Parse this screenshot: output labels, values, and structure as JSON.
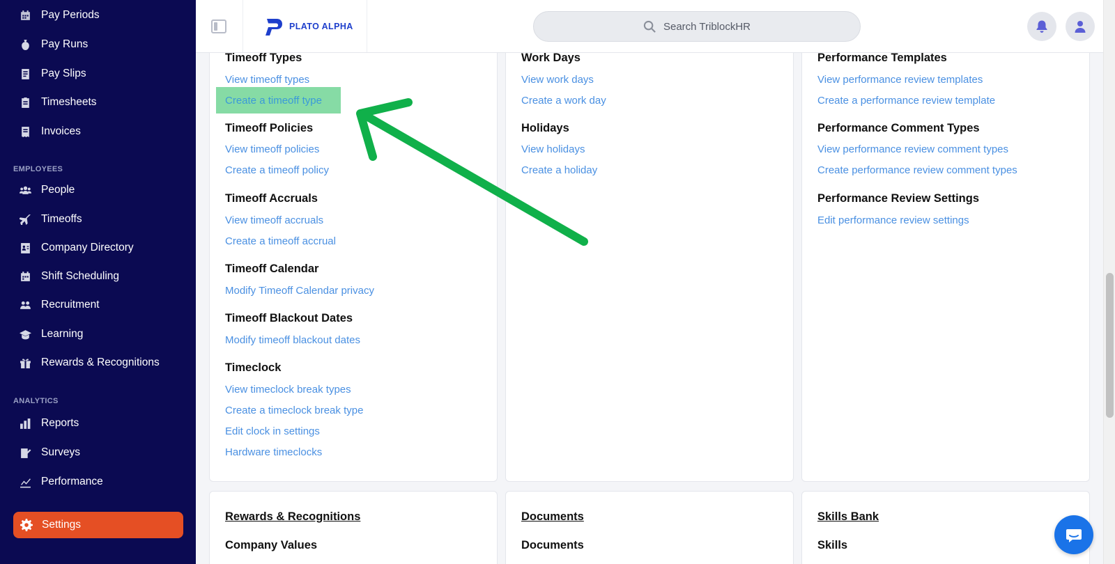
{
  "sidebar": {
    "top_items": [
      {
        "label": "Pay Periods",
        "icon": "calendar-icon"
      },
      {
        "label": "Pay Runs",
        "icon": "money-bag-icon"
      },
      {
        "label": "Pay Slips",
        "icon": "document-icon"
      },
      {
        "label": "Timesheets",
        "icon": "clipboard-icon"
      },
      {
        "label": "Invoices",
        "icon": "receipt-icon"
      }
    ],
    "employees_label": "EMPLOYEES",
    "employee_items": [
      {
        "label": "People",
        "icon": "people-icon"
      },
      {
        "label": "Timeoffs",
        "icon": "plane-icon"
      },
      {
        "label": "Company Directory",
        "icon": "directory-icon"
      },
      {
        "label": "Shift Scheduling",
        "icon": "calendar-icon"
      },
      {
        "label": "Recruitment",
        "icon": "recruit-icon"
      },
      {
        "label": "Learning",
        "icon": "graduation-icon"
      },
      {
        "label": "Rewards & Recognitions",
        "icon": "gift-icon"
      }
    ],
    "analytics_label": "ANALYTICS",
    "analytics_items": [
      {
        "label": "Reports",
        "icon": "bar-chart-icon"
      },
      {
        "label": "Surveys",
        "icon": "survey-icon"
      },
      {
        "label": "Performance",
        "icon": "trend-icon"
      }
    ],
    "active_item": {
      "label": "Settings",
      "icon": "gear-icon"
    }
  },
  "header": {
    "logo_text": "PLATO ALPHA",
    "search_placeholder": "Search TriblockHR"
  },
  "columns": {
    "col1": {
      "sections": [
        {
          "title": "Timeoff Types",
          "links": [
            "View timeoff types",
            "Create a timeoff type"
          ]
        },
        {
          "title": "Timeoff Policies",
          "links": [
            "View timeoff policies",
            "Create a timeoff policy"
          ]
        },
        {
          "title": "Timeoff Accruals",
          "links": [
            "View timeoff accruals",
            "Create a timeoff accrual"
          ]
        },
        {
          "title": "Timeoff Calendar",
          "links": [
            "Modify Timeoff Calendar privacy"
          ]
        },
        {
          "title": "Timeoff Blackout Dates",
          "links": [
            "Modify timeoff blackout dates"
          ]
        },
        {
          "title": "Timeclock",
          "links": [
            "View timeclock break types",
            "Create a timeclock break type",
            "Edit clock in settings",
            "Hardware timeclocks"
          ]
        }
      ]
    },
    "col2": {
      "sections": [
        {
          "title": "Work Days",
          "links": [
            "View work days",
            "Create a work day"
          ]
        },
        {
          "title": "Holidays",
          "links": [
            "View holidays",
            "Create a holiday"
          ]
        }
      ]
    },
    "col3": {
      "sections": [
        {
          "title": "Performance Templates",
          "links": [
            "View performance review templates",
            "Create a performance review template"
          ]
        },
        {
          "title": "Performance Comment Types",
          "links": [
            "View performance review comment types",
            "Create performance review comment types"
          ]
        },
        {
          "title": "Performance Review Settings",
          "links": [
            "Edit performance review settings"
          ]
        }
      ]
    }
  },
  "bottom_cards": [
    {
      "heading": "Rewards & Recognitions",
      "sub": "Company Values"
    },
    {
      "heading": "Documents",
      "sub": "Documents"
    },
    {
      "heading": "Skills Bank",
      "sub": "Skills"
    }
  ],
  "colors": {
    "sidebar_bg": "#0b0a52",
    "active_item": "#e54f24",
    "link": "#4a90e2",
    "highlight": "#86dba5",
    "arrow": "#10b04a"
  }
}
